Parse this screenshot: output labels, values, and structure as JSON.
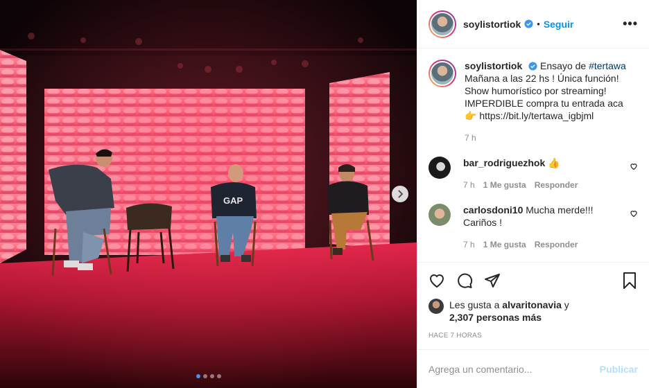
{
  "post": {
    "username": "soylistortiok",
    "follow_label": "Seguir",
    "more_icon": "more-options-icon",
    "caption_lines": [
      "Ensayo de",
      "#tertawa",
      "Mañana a las 22 hs ! Única función!",
      "Show humorístico por streaming!",
      "IMPERDIBLE compra tu entrada aca",
      "👉 https://bit.ly/tertawa_igbjml"
    ],
    "caption_time": "7 h",
    "colors": {
      "accent": "#0095f6",
      "dot_active": "#3897f0",
      "link": "#00376b"
    }
  },
  "comments": [
    {
      "username": "bar_rodriguezhok",
      "text": "👍",
      "time": "7 h",
      "likes": "1 Me gusta",
      "reply": "Responder"
    },
    {
      "username": "carlosdoni10",
      "text": "Mucha merde!!!",
      "text2": "Cariños !",
      "time": "7 h",
      "likes": "1 Me gusta",
      "reply": "Responder"
    }
  ],
  "likes": {
    "prefix": "Les gusta a",
    "user": "alvaritonavia",
    "connector": "y",
    "count": "2,307 personas más"
  },
  "timestamp": "HACE 7 HORAS",
  "add_comment": {
    "placeholder": "Agrega un comentario...",
    "publish": "Publicar"
  },
  "carousel": {
    "slides": 4,
    "active": 1
  }
}
